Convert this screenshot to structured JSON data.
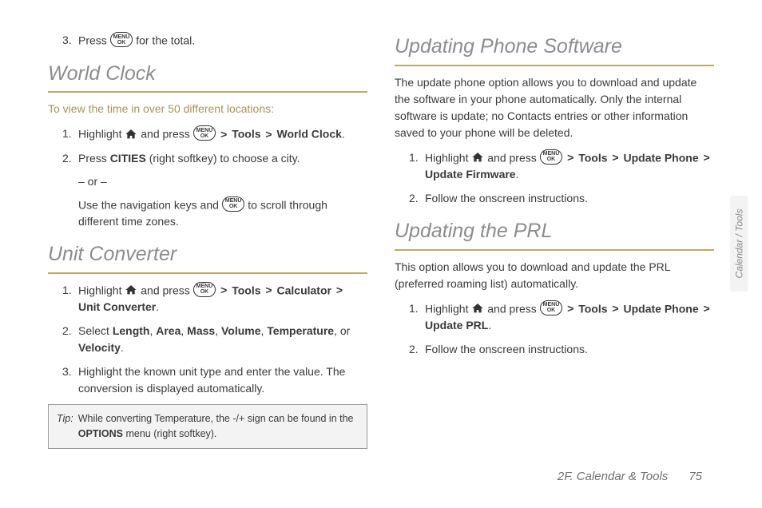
{
  "icons": {
    "menuok_top": "MENU",
    "menuok_bottom": "OK"
  },
  "left": {
    "topStep": {
      "num": "3.",
      "pre": "Press ",
      "post": " for the total."
    },
    "h1": "World Clock",
    "intro": "To view the time in over 50 different locations:",
    "wc": {
      "s1": {
        "num": "1.",
        "a": "Highlight ",
        "b": " and press ",
        "path": [
          "Tools",
          "World Clock"
        ]
      },
      "s2": {
        "num": "2.",
        "a": "Press ",
        "key": "CITIES",
        "b": " (right softkey) to choose a city."
      },
      "or": "– or –",
      "s2b": {
        "a": "Use the navigation keys and ",
        "b": " to scroll through different time zones."
      }
    },
    "h2": "Unit Converter",
    "uc": {
      "s1": {
        "num": "1.",
        "a": "Highlight ",
        "b": " and press ",
        "path": [
          "Tools",
          "Calculator",
          "Unit Converter"
        ]
      },
      "s2": {
        "num": "2.",
        "a": "Select ",
        "opts": [
          "Length",
          "Area",
          "Mass",
          "Volume",
          "Temperature"
        ],
        "or": ", or ",
        "last": "Velocity",
        "end": "."
      },
      "s3": {
        "num": "3.",
        "text": "Highlight the known unit type and enter the value. The conversion is displayed automatically."
      }
    },
    "tip": {
      "label": "Tip:",
      "a": "While converting Temperature, the -/+ sign can be found in the ",
      "key": "OPTIONS",
      "b": " menu (right softkey)."
    }
  },
  "right": {
    "h1": "Updating Phone Software",
    "p1": "The update phone option allows you to download and update the software in your phone automatically. Only the internal software is update; no Contacts entries or other information saved to your phone will be deleted.",
    "ups": {
      "s1": {
        "num": "1.",
        "a": "Highlight ",
        "b": " and press ",
        "path": [
          "Tools",
          "Update Phone",
          "Update Firmware"
        ]
      },
      "s2": {
        "num": "2.",
        "text": "Follow the onscreen instructions."
      }
    },
    "h2": "Updating the PRL",
    "p2": "This option allows you to download and update the PRL (preferred roaming list) automatically.",
    "prl": {
      "s1": {
        "num": "1.",
        "a": "Highlight ",
        "b": " and press ",
        "path": [
          "Tools",
          "Update Phone",
          "Update PRL"
        ]
      },
      "s2": {
        "num": "2.",
        "text": "Follow the onscreen instructions."
      }
    }
  },
  "tab": "Calendar / Tools",
  "footer": {
    "section": "2F. Calendar & Tools",
    "page": "75"
  }
}
